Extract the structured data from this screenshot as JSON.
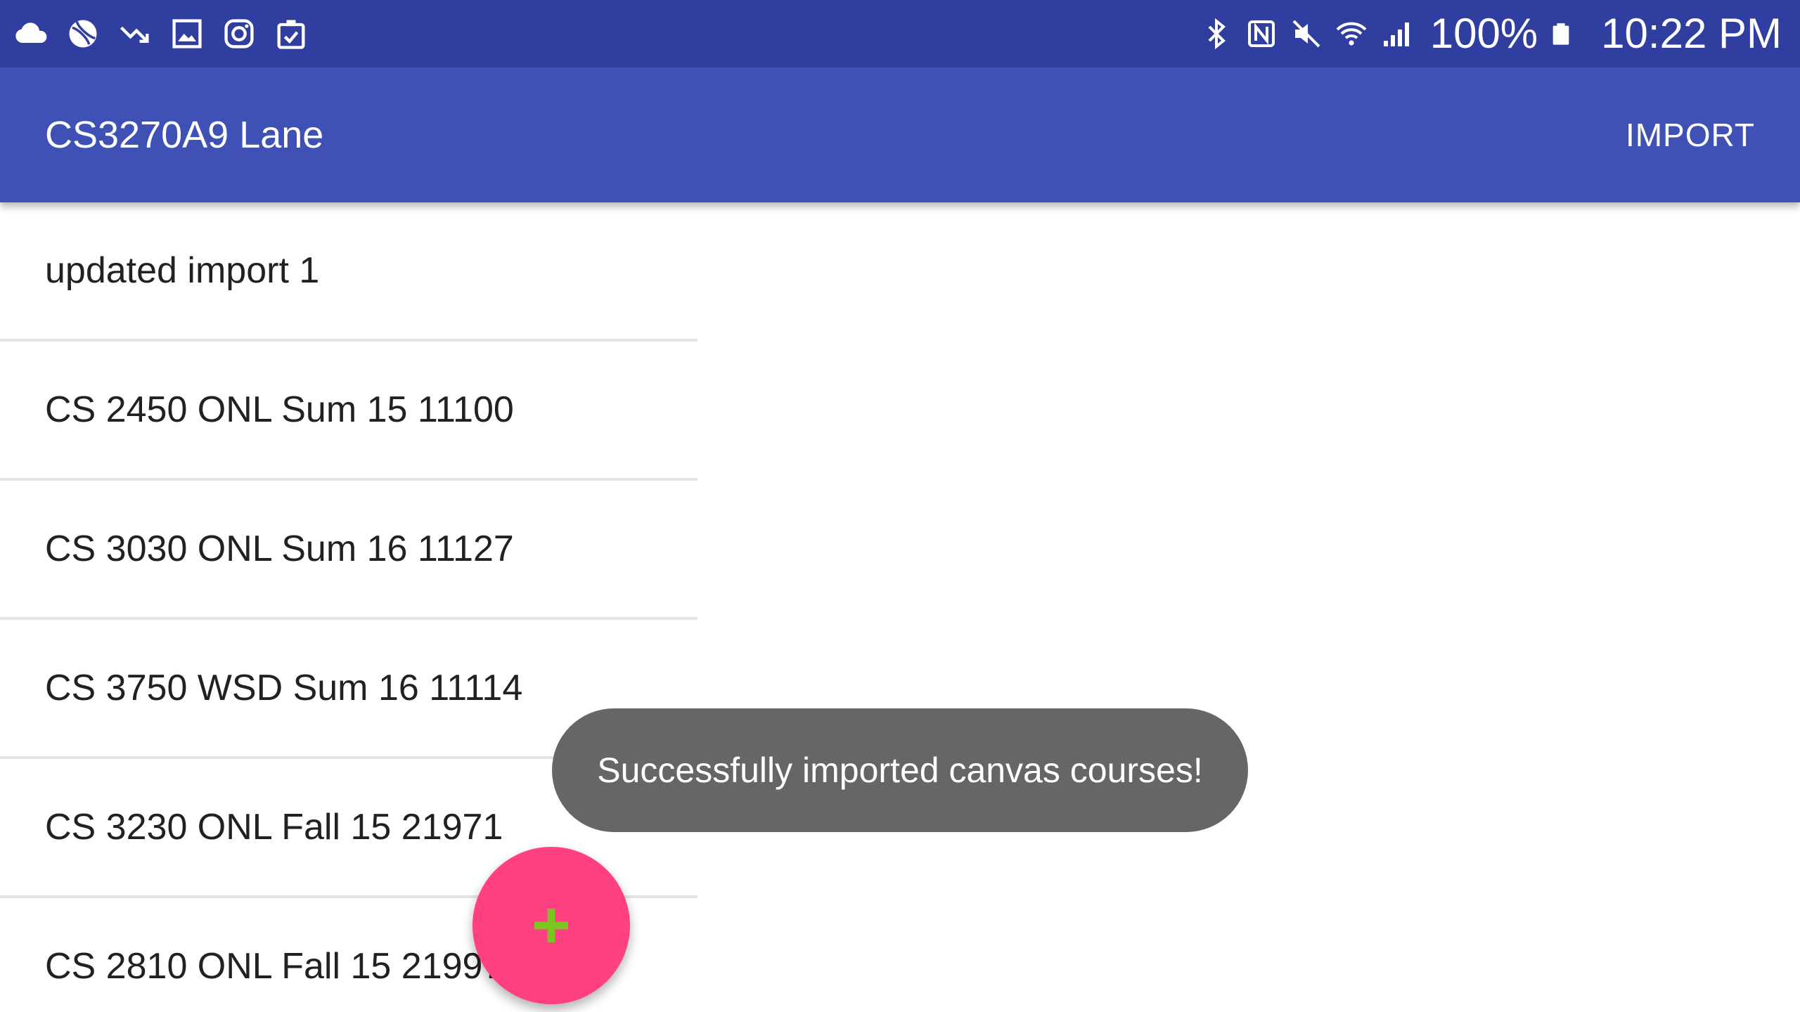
{
  "status_bar": {
    "left_icons": [
      "cloud-icon",
      "sports-ball-icon",
      "trending-down-icon",
      "image-icon",
      "instagram-icon",
      "clipboard-check-icon"
    ],
    "right_icons": [
      "bluetooth-icon",
      "nfc-icon",
      "mute-icon",
      "wifi-icon",
      "signal-icon",
      "battery-icon"
    ],
    "battery": "100%",
    "time": "10:22 PM"
  },
  "app_bar": {
    "title": "CS3270A9 Lane",
    "import_label": "IMPORT"
  },
  "courses": [
    {
      "label": "updated import 1"
    },
    {
      "label": "CS 2450 ONL Sum 15 11100"
    },
    {
      "label": "CS 3030 ONL Sum 16 11127"
    },
    {
      "label": "CS 3750 WSD Sum 16 11114"
    },
    {
      "label": "CS 3230 ONL Fall 15 21971"
    },
    {
      "label": "CS 2810 ONL Fall 15 21997"
    }
  ],
  "toast": {
    "message": "Successfully imported canvas courses!"
  },
  "fab": {
    "icon": "plus-icon",
    "icon_color": "#7cc520"
  },
  "colors": {
    "status_bar": "#303f9f",
    "primary": "#3f51b5",
    "accent": "#ff4081",
    "toast": "#666666"
  }
}
